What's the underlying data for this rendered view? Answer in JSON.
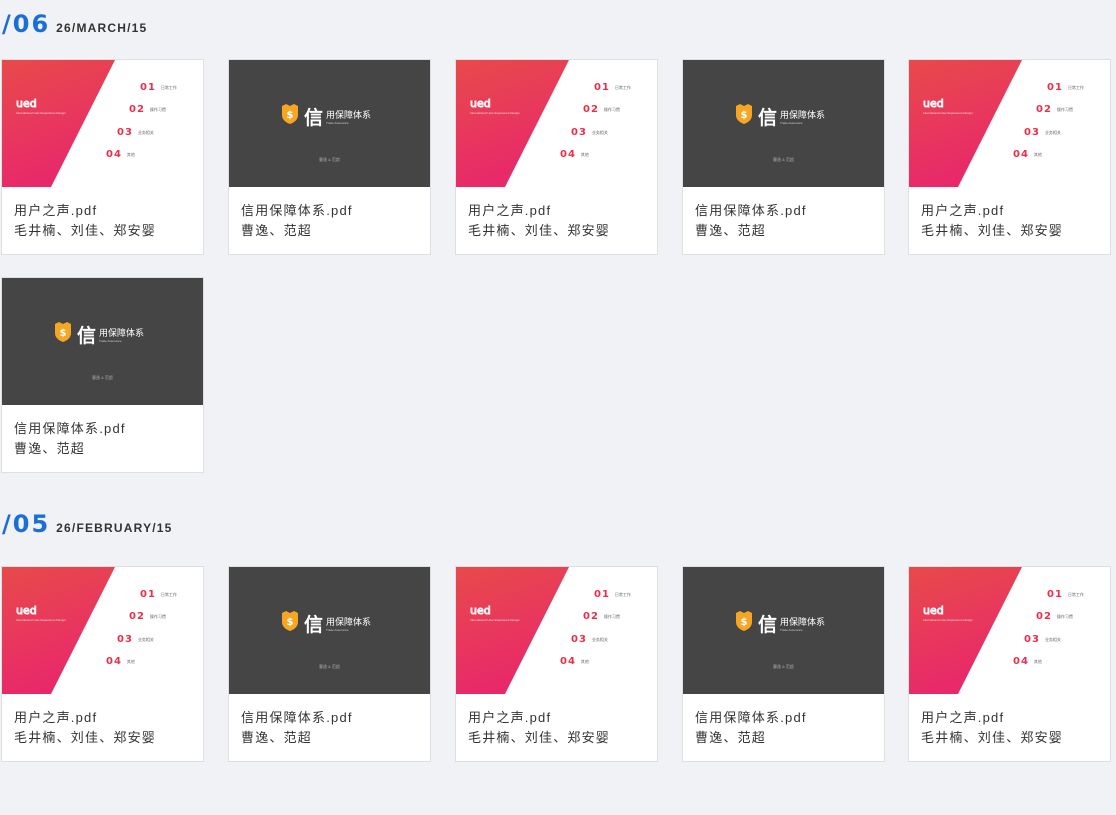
{
  "sections": [
    {
      "date_num": "/06",
      "date_text": "26/MARCH/15",
      "cards": [
        {
          "type": "light",
          "filename": "用户之声.pdf",
          "authors": "毛井楠、刘佳、郑安婴"
        },
        {
          "type": "dark",
          "filename": "信用保障体系.pdf",
          "authors": "曹逸、范超"
        },
        {
          "type": "light",
          "filename": "用户之声.pdf",
          "authors": "毛井楠、刘佳、郑安婴"
        },
        {
          "type": "dark",
          "filename": "信用保障体系.pdf",
          "authors": "曹逸、范超"
        },
        {
          "type": "light",
          "filename": "用户之声.pdf",
          "authors": "毛井楠、刘佳、郑安婴"
        },
        {
          "type": "dark",
          "filename": "信用保障体系.pdf",
          "authors": "曹逸、范超"
        }
      ]
    },
    {
      "date_num": "/05",
      "date_text": "26/FEBRUARY/15",
      "cards": [
        {
          "type": "light",
          "filename": "用户之声.pdf",
          "authors": "毛井楠、刘佳、郑安婴"
        },
        {
          "type": "dark",
          "filename": "信用保障体系.pdf",
          "authors": "曹逸、范超"
        },
        {
          "type": "light",
          "filename": "用户之声.pdf",
          "authors": "毛井楠、刘佳、郑安婴"
        },
        {
          "type": "dark",
          "filename": "信用保障体系.pdf",
          "authors": "曹逸、范超"
        },
        {
          "type": "light",
          "filename": "用户之声.pdf",
          "authors": "毛井楠、刘佳、郑安婴"
        }
      ]
    }
  ],
  "thumb_light": {
    "logo_text": "ued",
    "logo_sub": "International User Experience Design",
    "toc": [
      {
        "num": "01",
        "text": "日常工作"
      },
      {
        "num": "02",
        "text": "操作习惯"
      },
      {
        "num": "03",
        "text": "业务相关"
      },
      {
        "num": "04",
        "text": "其他"
      }
    ]
  },
  "thumb_dark": {
    "char": "信",
    "title": "用保障体系",
    "subtitle": "Trade Assurance",
    "footer": "曹逸 & 范超"
  },
  "colors": {
    "accent": "#1a6fd6",
    "gradient_start": "#e84a4a",
    "gradient_end": "#e8286b",
    "dark_thumb": "#454545",
    "shield": "#f5a623"
  }
}
